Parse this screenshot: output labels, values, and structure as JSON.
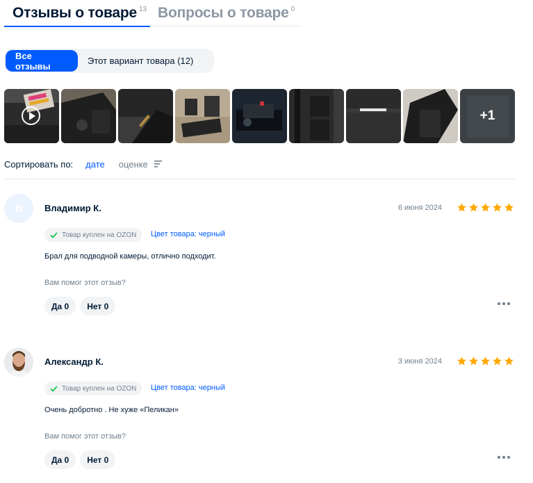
{
  "tabs": [
    {
      "label": "Отзывы о товаре",
      "count": "13"
    },
    {
      "label": "Вопросы о товаре",
      "count": "0"
    }
  ],
  "filter": {
    "all_label": "Все отзывы",
    "variant_label": "Этот вариант товара (12)"
  },
  "photos": {
    "more_label": "+1"
  },
  "sort": {
    "label": "Сортировать по:",
    "option_date": "дате",
    "option_rating": "оценке"
  },
  "reviews": [
    {
      "avatar_letter": "В",
      "author": "Владимир К.",
      "date": "6 июня 2024",
      "rating": 5,
      "badge": "Товар куплен на OZON",
      "color": "Цвет товара: черный",
      "text": "Брал для подводной камеры, отлично подходит.",
      "helpful_question": "Вам помог этот отзыв?",
      "yes_label": "Да 0",
      "no_label": "Нет 0"
    },
    {
      "avatar_letter": "",
      "author": "Александр К.",
      "date": "3 июня 2024",
      "rating": 5,
      "badge": "Товар куплен на OZON",
      "color": "Цвет товара: черный",
      "text": "Очень добротно . Не хуже «Пеликан»",
      "helpful_question": "Вам помог этот отзыв?",
      "yes_label": "Да 0",
      "no_label": "Нет 0"
    }
  ],
  "colors": {
    "accent": "#005bff",
    "star": "#ffa800",
    "check": "#10c44c",
    "text_secondary": "#707f8d"
  }
}
